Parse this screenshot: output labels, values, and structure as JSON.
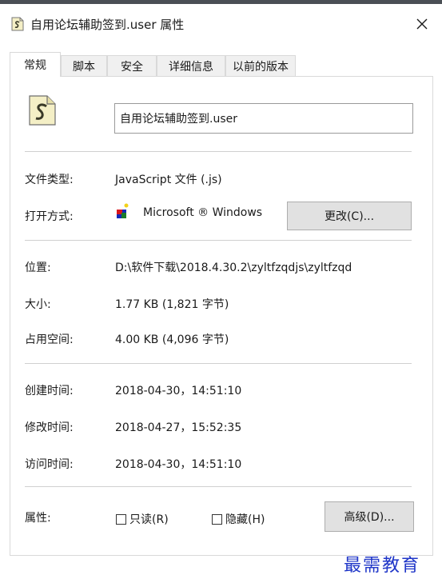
{
  "window": {
    "title": "自用论坛辅助签到.user 属性",
    "close_glyph": "✕"
  },
  "tabs": [
    {
      "label": "常规",
      "active": true
    },
    {
      "label": "脚本",
      "active": false
    },
    {
      "label": "安全",
      "active": false
    },
    {
      "label": "详细信息",
      "active": false
    },
    {
      "label": "以前的版本",
      "active": false
    }
  ],
  "general": {
    "filename": "自用论坛辅助签到.user",
    "file_type_label": "文件类型:",
    "file_type_value": "JavaScript 文件 (.js)",
    "open_with_label": "打开方式:",
    "open_with_value": "Microsoft ® Windows",
    "change_button": "更改(C)...",
    "location_label": "位置:",
    "location_value": "D:\\软件下载\\2018.4.30.2\\zyltfzqdjs\\zyltfzqd",
    "size_label": "大小:",
    "size_value": "1.77 KB (1,821 字节)",
    "size_on_disk_label": "占用空间:",
    "size_on_disk_value": "4.00 KB (4,096 字节)",
    "created_label": "创建时间:",
    "created_value": "2018-04-30，14:51:10",
    "modified_label": "修改时间:",
    "modified_value": "2018-04-27，15:52:35",
    "accessed_label": "访问时间:",
    "accessed_value": "2018-04-30，14:51:10",
    "attributes_label": "属性:",
    "readonly_label": "只读(R)",
    "hidden_label": "隐藏(H)",
    "advanced_button": "高级(D)..."
  },
  "watermark": "最需教育",
  "colors": {
    "watermark": "#1f36c8",
    "button_bg": "#e1e1e1"
  }
}
